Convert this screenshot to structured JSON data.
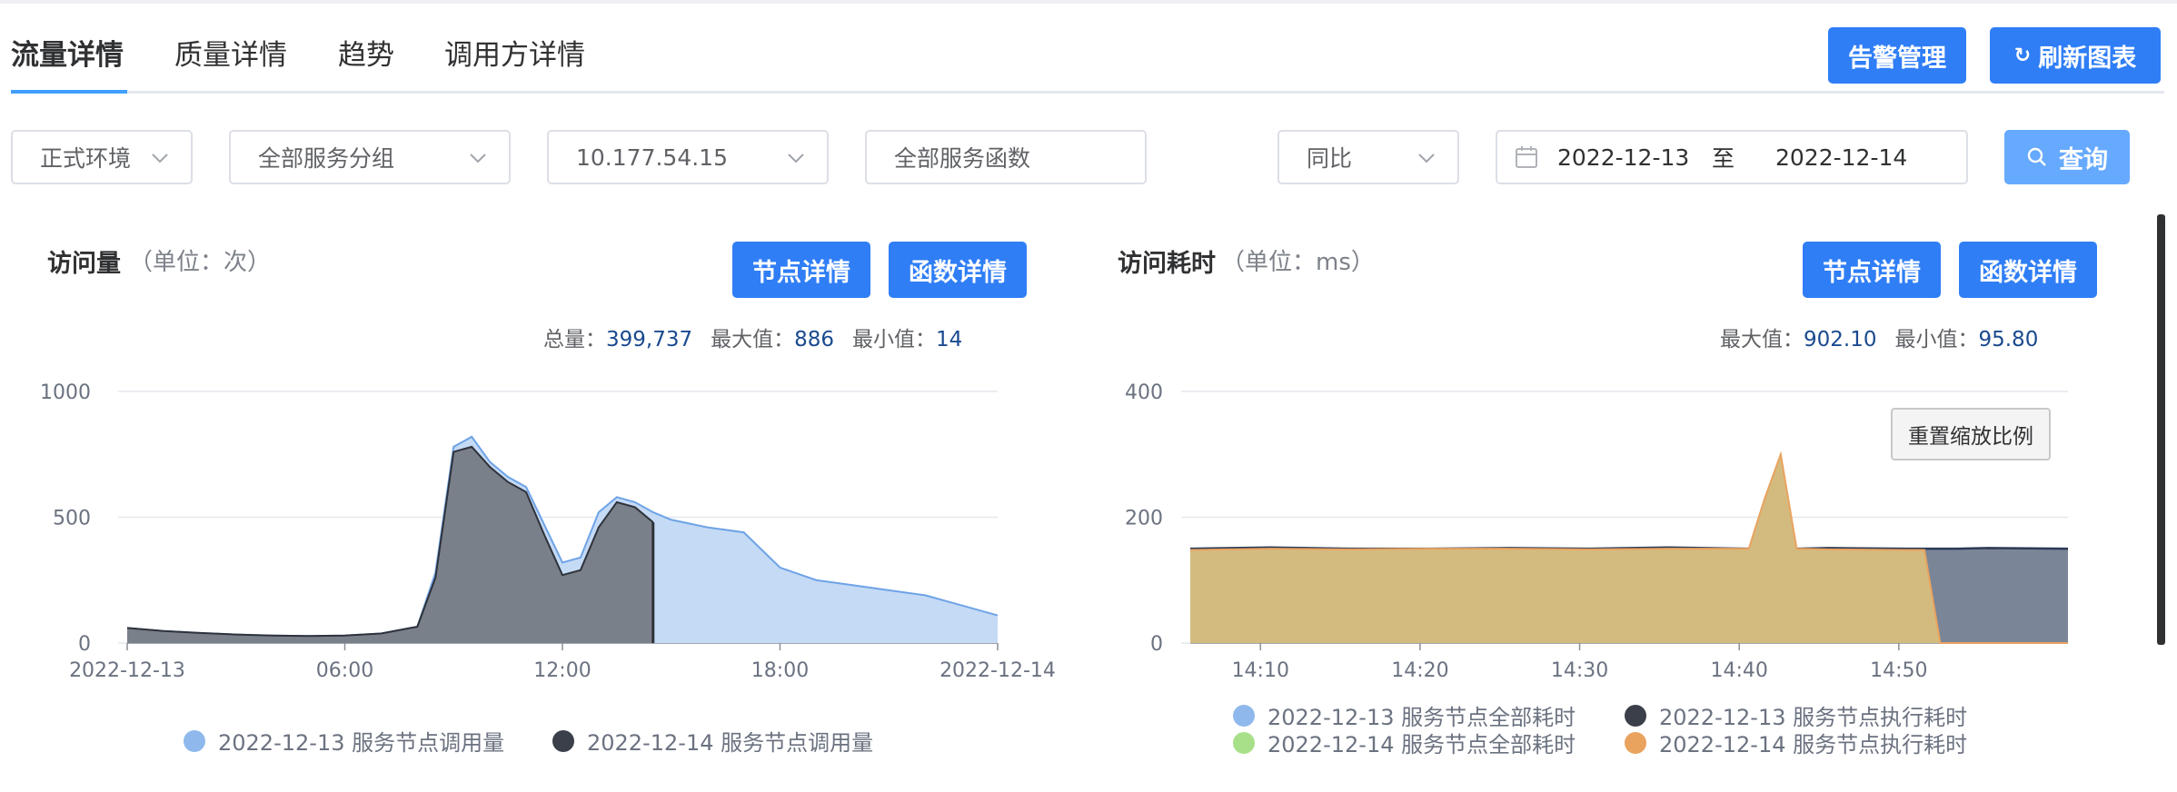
{
  "tabs": [
    {
      "label": "流量详情",
      "active": true
    },
    {
      "label": "质量详情",
      "active": false
    },
    {
      "label": "趋势",
      "active": false
    },
    {
      "label": "调用方详情",
      "active": false
    }
  ],
  "header_buttons": {
    "alarm": "告警管理",
    "refresh": "刷新图表"
  },
  "filters": {
    "env": "正式环境",
    "group": "全部服务分组",
    "ip": "10.177.54.15",
    "func": "全部服务函数",
    "compare": "同比",
    "date_start": "2022-12-13",
    "date_sep": "至",
    "date_end": "2022-12-14",
    "query": "查询"
  },
  "left_panel": {
    "title": "访问量",
    "unit": "（单位：次）",
    "btn_node": "节点详情",
    "btn_func": "函数详情",
    "stats": {
      "total_label": "总量：",
      "total": "399,737",
      "max_label": "最大值：",
      "max": "886",
      "min_label": "最小值：",
      "min": "14"
    },
    "legend": [
      "2022-12-13 服务节点调用量",
      "2022-12-14 服务节点调用量"
    ]
  },
  "right_panel": {
    "title": "访问耗时",
    "unit": "（单位：ms）",
    "btn_node": "节点详情",
    "btn_func": "函数详情",
    "stats": {
      "max_label": "最大值：",
      "max": "902.10",
      "min_label": "最小值：",
      "min": "95.80"
    },
    "reset_zoom": "重置缩放比例",
    "legend": [
      "2022-12-13 服务节点全部耗时",
      "2022-12-13 服务节点执行耗时",
      "2022-12-14 服务节点全部耗时",
      "2022-12-14 服务节点执行耗时"
    ]
  },
  "colors": {
    "accent": "#2f7ef6",
    "series_blue": "#8fb9ec",
    "series_dark": "#3a3f49",
    "series_green": "#a8e08a",
    "series_orange": "#e9a35f"
  },
  "chart_data": [
    {
      "type": "area",
      "title": "访问量",
      "ylabel": "（单位：次）",
      "ylim": [
        0,
        1000
      ],
      "yticks": [
        0,
        500,
        1000
      ],
      "xticks": [
        "2022-12-13",
        "06:00",
        "12:00",
        "18:00",
        "2022-12-14"
      ],
      "x_hours": [
        0,
        1,
        2,
        3,
        4,
        5,
        6,
        7,
        8,
        8.5,
        9,
        9.5,
        10,
        10.5,
        11,
        11.5,
        12,
        12.5,
        13,
        13.5,
        14,
        14.5,
        15,
        16,
        17,
        18,
        19,
        20,
        21,
        22,
        23,
        24
      ],
      "series": [
        {
          "name": "2022-12-13 服务节点调用量",
          "values": [
            60,
            48,
            40,
            34,
            30,
            28,
            30,
            38,
            65,
            280,
            780,
            820,
            720,
            660,
            620,
            470,
            320,
            340,
            520,
            580,
            560,
            520,
            490,
            460,
            440,
            300,
            250,
            230,
            210,
            190,
            150,
            110
          ]
        },
        {
          "name": "2022-12-14 服务节点调用量",
          "values": [
            60,
            48,
            40,
            34,
            30,
            28,
            30,
            38,
            65,
            260,
            760,
            780,
            700,
            640,
            600,
            430,
            270,
            290,
            460,
            560,
            540,
            480,
            null,
            null,
            null,
            null,
            null,
            null,
            null,
            null,
            null,
            null
          ]
        }
      ]
    },
    {
      "type": "area",
      "title": "访问耗时",
      "ylabel": "（单位：ms）",
      "ylim": [
        0,
        400
      ],
      "yticks": [
        0,
        200,
        400
      ],
      "xticks": [
        "14:10",
        "14:20",
        "14:30",
        "14:40",
        "14:50"
      ],
      "x_minutes": [
        0,
        5,
        10,
        15,
        20,
        25,
        30,
        35,
        36,
        37,
        38,
        40,
        45,
        46,
        47,
        48,
        50,
        55
      ],
      "series": [
        {
          "name": "2022-12-13 服务节点全部耗时",
          "values": [
            150,
            152,
            150,
            150,
            151,
            150,
            152,
            150,
            150,
            150,
            150,
            151,
            150,
            150,
            150,
            150,
            151,
            150
          ]
        },
        {
          "name": "2022-12-13 服务节点执行耗时",
          "values": [
            150,
            152,
            150,
            150,
            151,
            150,
            152,
            150,
            150,
            150,
            150,
            151,
            150,
            150,
            150,
            150,
            151,
            150
          ]
        },
        {
          "name": "2022-12-14 服务节点全部耗时",
          "values": [
            148,
            150,
            149,
            150,
            150,
            149,
            150,
            150,
            150,
            150,
            150,
            149,
            148,
            148,
            0,
            0,
            0,
            0
          ]
        },
        {
          "name": "2022-12-14 服务节点执行耗时",
          "values": [
            148,
            150,
            149,
            150,
            150,
            149,
            150,
            150,
            230,
            300,
            150,
            149,
            148,
            148,
            0,
            0,
            0,
            0
          ]
        }
      ]
    }
  ]
}
